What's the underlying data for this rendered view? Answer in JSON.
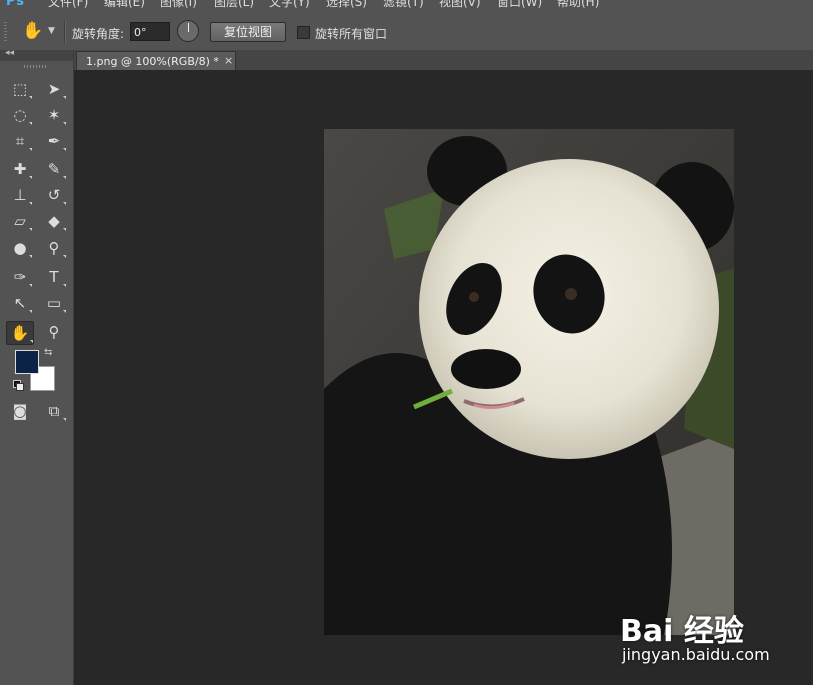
{
  "menu": {
    "logo": "Ps",
    "items": [
      "文件(F)",
      "编辑(E)",
      "图像(I)",
      "图层(L)",
      "文字(Y)",
      "选择(S)",
      "滤镜(T)",
      "视图(V)",
      "窗口(W)",
      "帮助(H)"
    ]
  },
  "options_bar": {
    "tool_icon": "hand-rotate-icon",
    "angle_label": "旋转角度:",
    "angle_value": "0°",
    "reset_view_button": "复位视图",
    "rotate_all_label": "旋转所有窗口",
    "rotate_all_checked": false,
    "highlight_color": "#e0231b"
  },
  "toolbox": {
    "collapse_label": "◂◂",
    "foreground_color": "#0b2346",
    "background_color": "#ffffff",
    "tools": [
      "marquee-icon",
      "move-icon",
      "lasso-icon",
      "magic-wand-icon",
      "crop-icon",
      "eyedropper-icon",
      "spot-healing-icon",
      "brush-icon",
      "clone-stamp-icon",
      "history-brush-icon",
      "eraser-icon",
      "paint-bucket-icon",
      "blur-icon",
      "dodge-icon",
      "pen-icon",
      "type-icon",
      "path-selection-icon",
      "rectangle-icon",
      "rotate-view-icon",
      "zoom-icon",
      "quick-mask-icon",
      "screen-mode-icon"
    ],
    "type_tool_glyph": "T"
  },
  "document": {
    "tab_title": "1.png @ 100%(RGB/8) *",
    "close_glyph": "×",
    "image_subject": "panda"
  },
  "watermark": {
    "brand": "Bai  经验",
    "url": "jingyan.baidu.com"
  }
}
